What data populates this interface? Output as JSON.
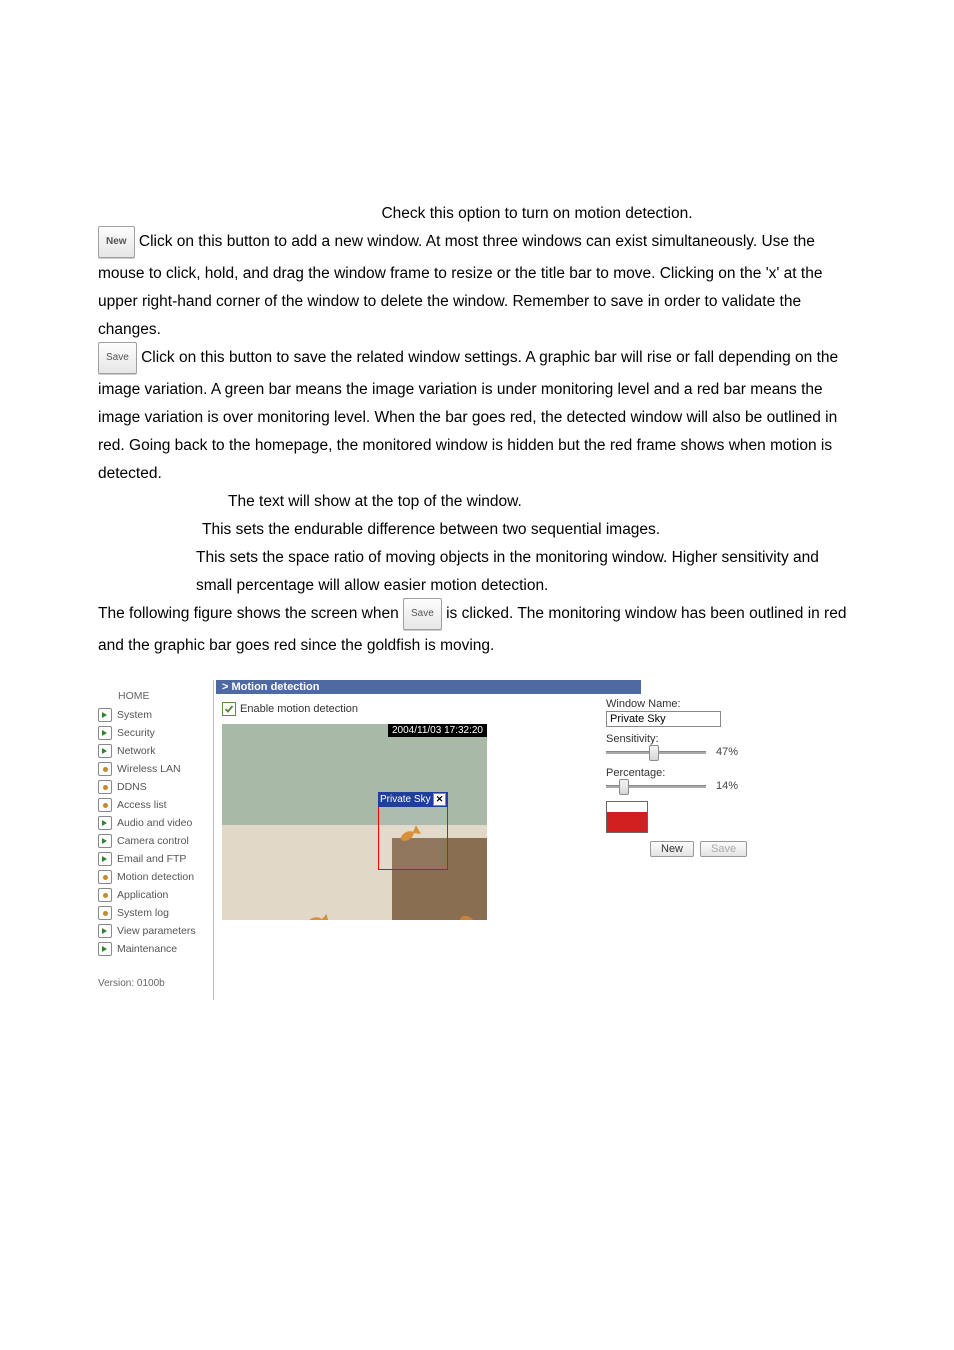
{
  "body": {
    "checkOption": "Check this option to turn on motion detection.",
    "newBtnLabel": "New",
    "newBtnText": " Click on this button to add a new window. At most three windows can exist simultaneously. Use the mouse to click, hold, and drag the window frame to resize or the title bar to move. Clicking on the 'x' at the upper right-hand corner of the window to delete the window. Remember to save in order to validate the changes.",
    "saveBtnLabel": "Save",
    "saveBtnText": " Click on this button to save the related window settings. A graphic bar will rise or fall depending on the image variation. A green bar means the image variation is under monitoring level and a red bar means the image variation is over monitoring level. When the bar goes red, the detected window will also be outlined in red. Going back to the homepage, the monitored window is hidden but the red frame shows when motion is detected.",
    "windowNameDesc": "The text will show at the top of the window.",
    "sensitivityDesc": "This sets the endurable difference between two sequential images.",
    "percentageDesc": " This sets the space ratio of moving objects in the monitoring window. Higher sensitivity and small percentage will allow easier motion detection.",
    "followingPre": "The following figure shows the screen when ",
    "followingSaveLabel": "Save",
    "followingPost": " is clicked. The monitoring window has been outlined in red and the graphic bar goes red since the goldfish is moving."
  },
  "figure": {
    "nav": {
      "home": "HOME",
      "items": [
        {
          "label": "System",
          "icon": "arrow"
        },
        {
          "label": "Security",
          "icon": "arrow"
        },
        {
          "label": "Network",
          "icon": "arrow"
        },
        {
          "label": "Wireless LAN",
          "icon": "dot"
        },
        {
          "label": "DDNS",
          "icon": "dot"
        },
        {
          "label": "Access list",
          "icon": "dot"
        },
        {
          "label": "Audio and video",
          "icon": "arrow"
        },
        {
          "label": "Camera control",
          "icon": "arrow"
        },
        {
          "label": "Email and FTP",
          "icon": "arrow"
        },
        {
          "label": "Motion detection",
          "icon": "dot"
        },
        {
          "label": "Application",
          "icon": "dot"
        },
        {
          "label": "System log",
          "icon": "dot"
        },
        {
          "label": "View parameters",
          "icon": "arrow"
        },
        {
          "label": "Maintenance",
          "icon": "arrow"
        }
      ],
      "version": "Version: 0100b"
    },
    "panel": {
      "header": "> Motion detection",
      "enableLabel": "Enable motion detection",
      "timestamp": "2004/11/03 17:32:20",
      "regionTitle": "Private Sky",
      "controls": {
        "windowNameLabel": "Window Name:",
        "windowNameValue": "Private Sky",
        "sensitivityLabel": "Sensitivity:",
        "sensitivityValue": "47%",
        "sensitivityPos": 47,
        "percentageLabel": "Percentage:",
        "percentageValue": "14%",
        "percentagePos": 14,
        "newBtn": "New",
        "saveBtn": "Save"
      }
    }
  }
}
